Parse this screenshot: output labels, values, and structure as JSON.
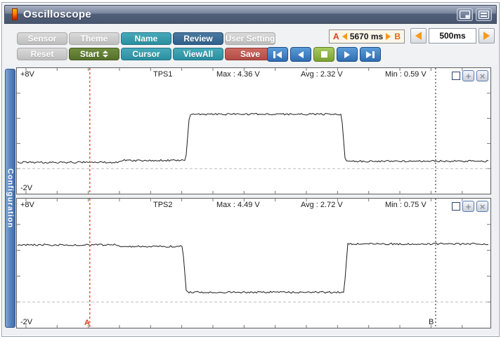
{
  "window": {
    "title": "Oscilloscope"
  },
  "icons": {
    "app_icon": "thermometer-bar-icon",
    "titlebar": [
      "window-mode-icon",
      "layout-list-icon"
    ],
    "plus_glyph": "+",
    "close_glyph": "×"
  },
  "toolbar": {
    "rows": [
      [
        {
          "label": "Sensor",
          "style": "gray"
        },
        {
          "label": "Theme",
          "style": "gray"
        },
        {
          "label": "Name",
          "style": "teal"
        },
        {
          "label": "Review",
          "style": "blue"
        },
        {
          "label": "User Setting",
          "style": "gray"
        }
      ],
      [
        {
          "label": "Reset",
          "style": "gray"
        },
        {
          "label": "Start",
          "style": "green",
          "spinner": true
        },
        {
          "label": "Cursor",
          "style": "teal"
        },
        {
          "label": "ViewAll",
          "style": "teal"
        },
        {
          "label": "Save",
          "style": "red"
        }
      ]
    ],
    "playback": [
      "skip-to-start",
      "step-back",
      "stop",
      "play",
      "skip-to-end"
    ],
    "ab_readout": {
      "a": "A",
      "value": "5670 ms",
      "b": "B"
    },
    "timebase": {
      "value": "500ms"
    }
  },
  "sidebar": {
    "label": "Configuration"
  },
  "cursor_labels": {
    "a": "A",
    "b": "B"
  },
  "panels": [
    {
      "v_top": "+8V",
      "v_bottom": "-2V",
      "name": "TPS1",
      "max": "Max : 4.36 V",
      "avg": "Avg : 2.32 V",
      "min": "Min : 0.59 V"
    },
    {
      "v_top": "+8V",
      "v_bottom": "-2V",
      "name": "TPS2",
      "max": "Max : 4.49 V",
      "avg": "Avg : 2.72 V",
      "min": "Min : 0.75 V"
    }
  ],
  "colors": {
    "teal_button": "#2f9aab",
    "blue_button": "#35658f",
    "green_button": "#5d7a30",
    "red_button": "#bb5049",
    "playback_blue": "#3d7fc1",
    "stop_green": "#8cb13f",
    "cursor_a_red": "#f4564a",
    "cursor_b_black": "#2b2b2b",
    "config_tab_blue": "#4f7cb8",
    "ab_box_bg": "#faf6e9",
    "orange_arrow": "#f59a1c"
  },
  "chart_data": [
    {
      "type": "line",
      "title": "TPS1",
      "x_unit": "ms",
      "y_unit": "V",
      "x_range": [
        0,
        7600
      ],
      "y_range": [
        -2,
        8
      ],
      "x_tick_ms": 500,
      "x_tick_offset_ms": 146,
      "y_tick_v": 2,
      "zero_line": true,
      "points": [
        [
          0,
          0.5
        ],
        [
          1620,
          0.5
        ],
        [
          1660,
          0.65
        ],
        [
          2710,
          0.65
        ],
        [
          2770,
          4.33
        ],
        [
          5210,
          4.33
        ],
        [
          5270,
          0.59
        ],
        [
          7600,
          0.59
        ]
      ],
      "stats": {
        "max": 4.36,
        "avg": 2.32,
        "min": 0.59
      },
      "cursors": {
        "A": 1170,
        "B": 6720
      },
      "noise_v": 0.07
    },
    {
      "type": "line",
      "title": "TPS2",
      "x_unit": "ms",
      "y_unit": "V",
      "x_range": [
        0,
        7600
      ],
      "y_range": [
        -2,
        8
      ],
      "x_tick_ms": 500,
      "x_tick_offset_ms": 146,
      "y_tick_v": 2,
      "zero_line": true,
      "points": [
        [
          0,
          4.42
        ],
        [
          1620,
          4.42
        ],
        [
          1660,
          4.3
        ],
        [
          2660,
          4.3
        ],
        [
          2720,
          0.75
        ],
        [
          5250,
          0.75
        ],
        [
          5310,
          4.49
        ],
        [
          7600,
          4.49
        ]
      ],
      "stats": {
        "max": 4.49,
        "avg": 2.72,
        "min": 0.75
      },
      "cursors": {
        "A": 1170,
        "B": 6720
      },
      "noise_v": 0.07
    }
  ]
}
